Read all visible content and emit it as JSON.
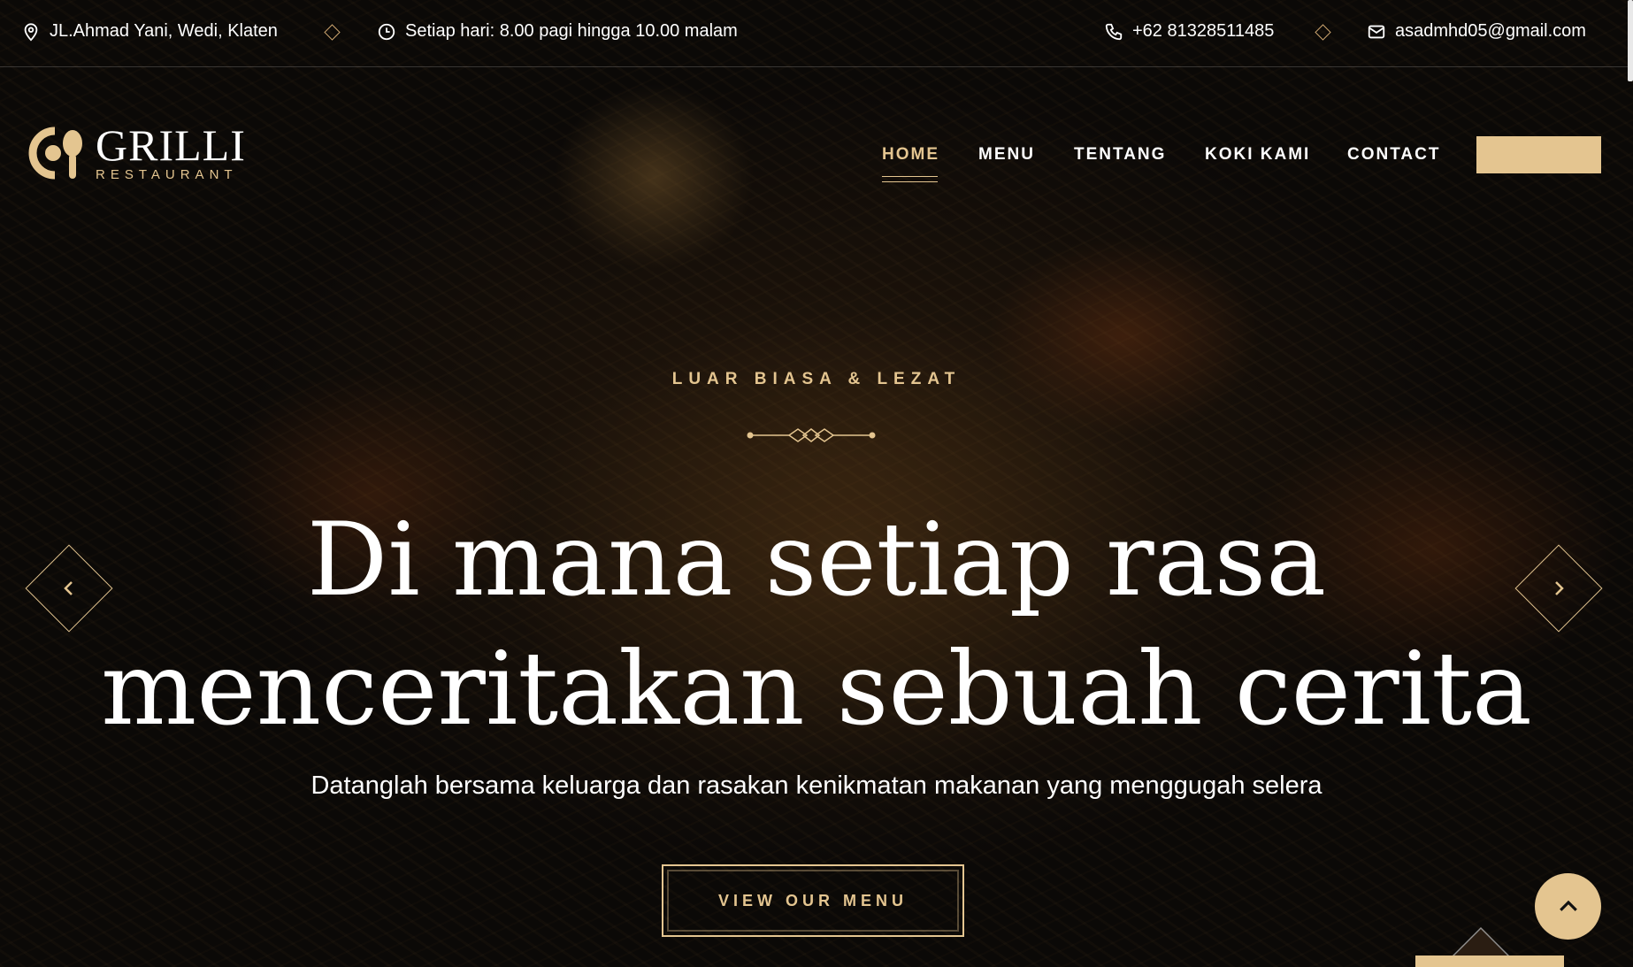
{
  "topbar": {
    "address": "JL.Ahmad Yani, Wedi, Klaten",
    "hours": "Setiap hari: 8.00 pagi hingga 10.00 malam",
    "phone": "+62 81328511485",
    "email": "asadmhd05@gmail.com",
    "icons": [
      "location-pin-icon",
      "clock-icon",
      "phone-icon",
      "mail-icon"
    ]
  },
  "logo": {
    "title": "GRILLI",
    "subtitle": "RESTAURANT"
  },
  "nav": {
    "items": [
      {
        "label": "HOME",
        "active": true
      },
      {
        "label": "MENU",
        "active": false
      },
      {
        "label": "TENTANG",
        "active": false
      },
      {
        "label": "KOKI KAMI",
        "active": false
      },
      {
        "label": "CONTACT",
        "active": false
      }
    ]
  },
  "hero": {
    "eyebrow": "LUAR BIASA & LEZAT",
    "headline_line1": "Di mana setiap rasa",
    "headline_line2": "menceritakan sebuah cerita",
    "subheadline": "Datanglah bersama keluarga dan rasakan kenikmatan makanan yang menggugah selera",
    "cta_label": "VIEW OUR MENU"
  },
  "colors": {
    "accent": "#e4c590",
    "background": "#15110e",
    "text": "#ffffff"
  }
}
